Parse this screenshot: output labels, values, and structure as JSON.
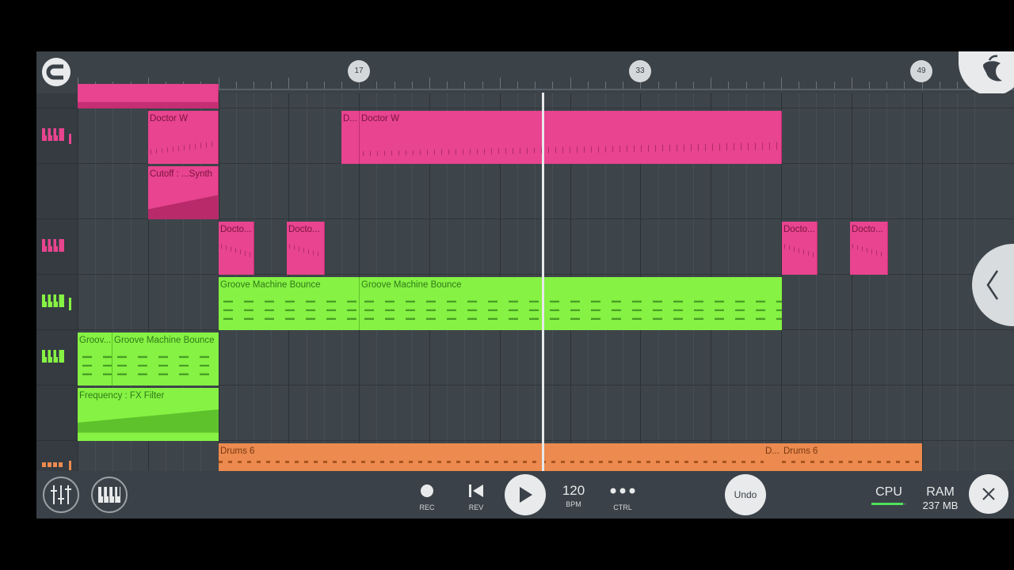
{
  "ruler": {
    "markers": [
      "17",
      "33",
      "49"
    ]
  },
  "clips": {
    "doctor_w_1": "Doctor W",
    "cutoff": "Cutoff : ...Synth",
    "doctor_w_2_short": "D...",
    "doctor_w_2": "Doctor W",
    "docto_1": "Docto...",
    "docto_2": "Docto...",
    "docto_3": "Docto...",
    "docto_4": "Docto...",
    "groove_a": "Groove Machine Bounce",
    "groove_b": "Groove Machine Bounce",
    "groov_short": "Groov...",
    "groove_c": "Groove Machine Bounce",
    "frequency": "Frequency : FX Filter",
    "drums_a": "Drums 6",
    "drums_short": "D...",
    "drums_b": "Drums 6"
  },
  "transport": {
    "rec_label": "REC",
    "rev_label": "REV",
    "tempo": "120",
    "tempo_unit": "BPM",
    "ctrl_label": "CTRL",
    "undo_label": "Undo"
  },
  "stats": {
    "cpu_label": "CPU",
    "ram_label": "RAM",
    "ram_value": "237 MB"
  },
  "colors": {
    "pink": "#e8448f",
    "green": "#86f243",
    "orange": "#ec8a4f",
    "background": "#3a4148"
  }
}
